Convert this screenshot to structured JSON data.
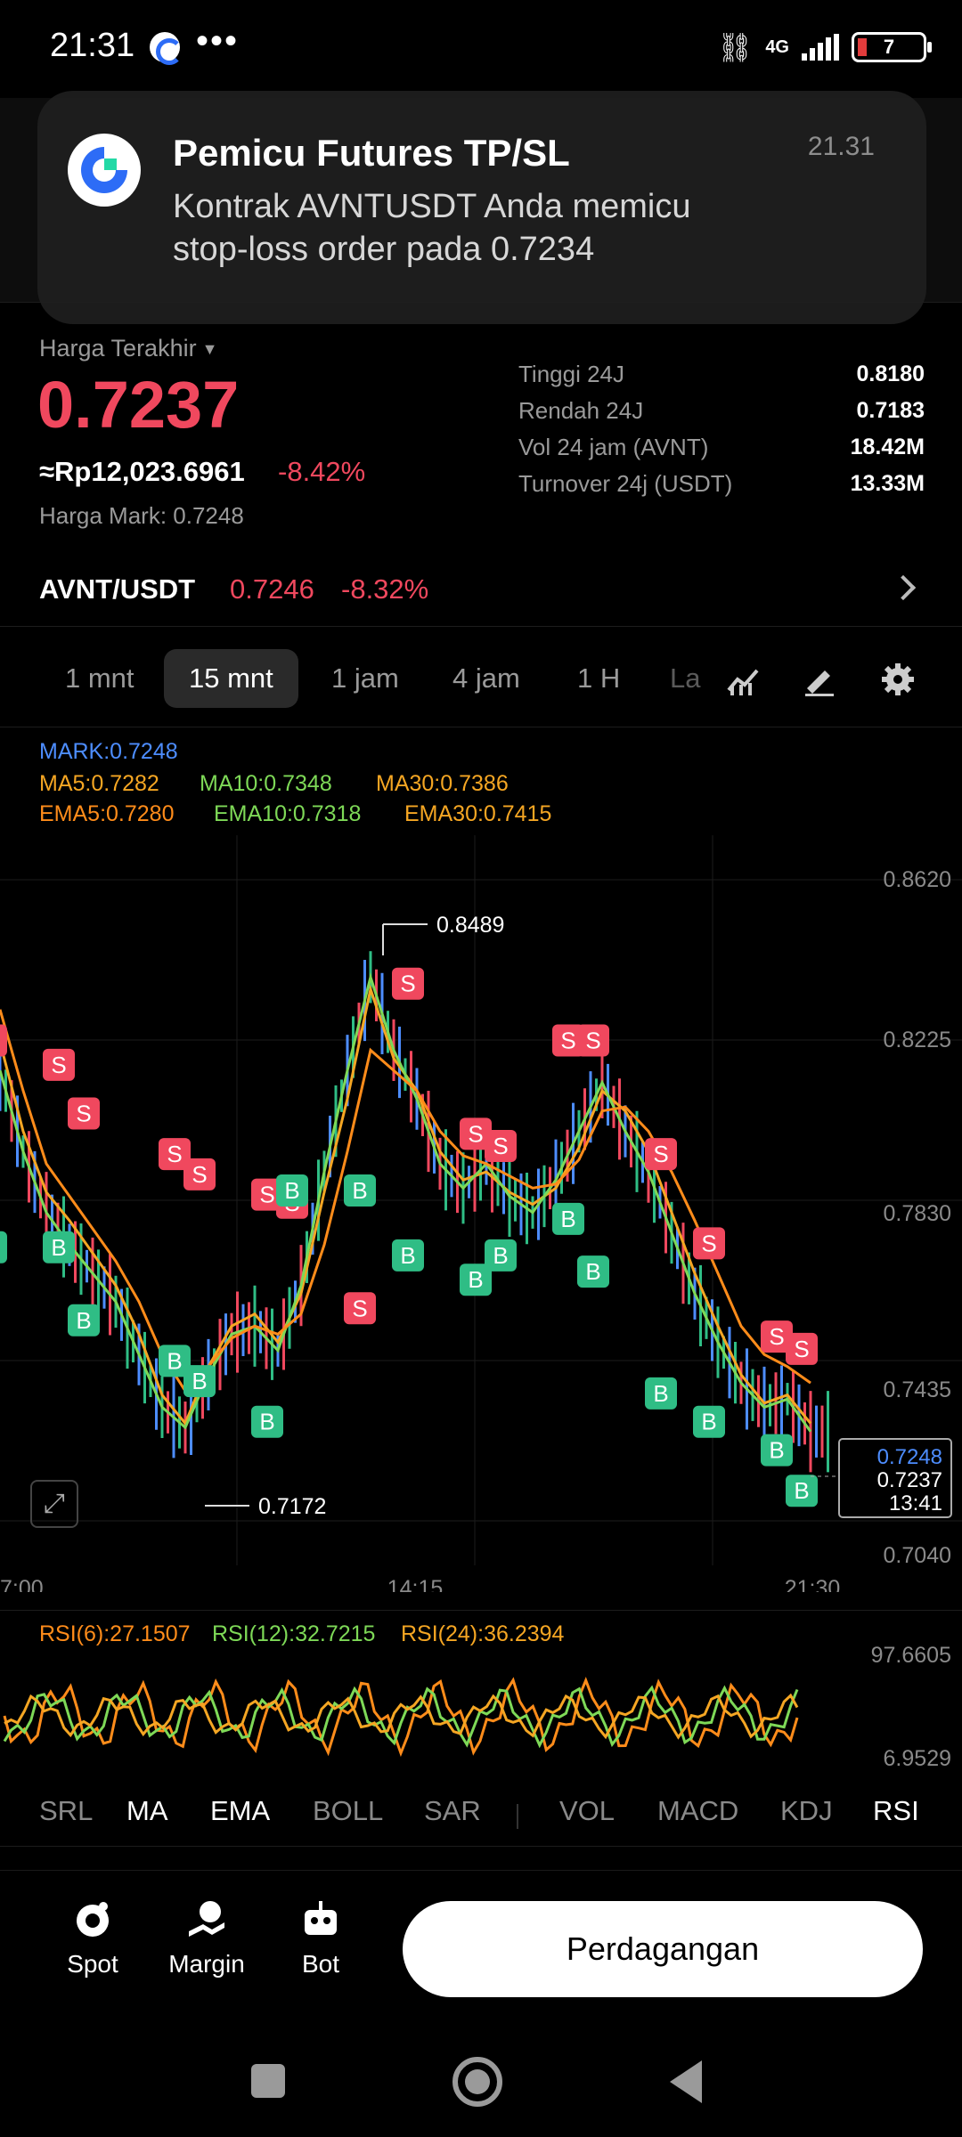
{
  "status_bar": {
    "time": "21:31",
    "dots": "•••",
    "network": "4G",
    "battery": "7"
  },
  "notification": {
    "title": "Pemicu Futures TP/SL",
    "time": "21.31",
    "body": "Kontrak AVNTUSDT Anda memicu stop-loss order pada 0.7234",
    "app_icon": "gate-logo-icon"
  },
  "ticker": {
    "last_price_label": "Harga Terakhir",
    "last_price": "0.7237",
    "idr_value": "≈Rp12,023.6961",
    "change_pct": "-8.42%",
    "mark_label": "Harga Mark:",
    "mark_value": "0.7248",
    "stats": [
      {
        "label": "Tinggi 24J",
        "value": "0.8180"
      },
      {
        "label": "Rendah 24J",
        "value": "0.7183"
      },
      {
        "label": "Vol 24 jam (AVNT)",
        "value": "18.42M"
      },
      {
        "label": "Turnover 24j (USDT)",
        "value": "13.33M"
      }
    ],
    "pair": {
      "name": "AVNT/USDT",
      "price": "0.7246",
      "change": "-8.32%"
    },
    "down_color": "#f0485e",
    "up_color": "#2fbd85"
  },
  "intervals": {
    "items": [
      "1 mnt",
      "15 mnt",
      "1 jam",
      "4 jam",
      "1 H",
      "La"
    ],
    "active": "15 mnt",
    "tools": [
      "indicator-icon",
      "draw-pen-icon",
      "settings-gear-icon"
    ]
  },
  "indicators_legend": {
    "mark": "MARK:0.7248",
    "ma5": "MA5:0.7282",
    "ma10": "MA10:0.7348",
    "ma30": "MA30:0.7386",
    "ema5": "EMA5:0.7280",
    "ema10": "EMA10:0.7318",
    "ema30": "EMA30:0.7415"
  },
  "chart_data": {
    "type": "line",
    "y_ticks": [
      "0.8620",
      "0.8225",
      "0.7830",
      "0.7435",
      "0.7040"
    ],
    "ylim": [
      0.704,
      0.862
    ],
    "x_ticks": [
      "7:00",
      "14:15",
      "21:30"
    ],
    "high_label": "0.8489",
    "low_label": "0.7172",
    "current_mark": "0.7248",
    "current_last": "0.7237",
    "countdown": "13:41",
    "series": [
      {
        "color": "#f5a623",
        "values": [
          0.822,
          0.8,
          0.785,
          0.778,
          0.77,
          0.762,
          0.75,
          0.735,
          0.728,
          0.742,
          0.752,
          0.755,
          0.748,
          0.76,
          0.785,
          0.808,
          0.835,
          0.818,
          0.81,
          0.795,
          0.788,
          0.79,
          0.785,
          0.782,
          0.786,
          0.796,
          0.81,
          0.805,
          0.795,
          0.78,
          0.765,
          0.752,
          0.74,
          0.733,
          0.735,
          0.728
        ]
      },
      {
        "color": "#7ed957",
        "values": [
          0.815,
          0.795,
          0.78,
          0.772,
          0.765,
          0.758,
          0.745,
          0.732,
          0.727,
          0.74,
          0.75,
          0.752,
          0.746,
          0.762,
          0.79,
          0.815,
          0.838,
          0.82,
          0.808,
          0.792,
          0.786,
          0.792,
          0.784,
          0.78,
          0.788,
          0.8,
          0.812,
          0.8,
          0.79,
          0.775,
          0.76,
          0.748,
          0.738,
          0.732,
          0.734,
          0.726
        ]
      },
      {
        "color": "#ff8c1a",
        "values": [
          0.83,
          0.81,
          0.792,
          0.784,
          0.776,
          0.768,
          0.758,
          0.745,
          0.736,
          0.742,
          0.749,
          0.752,
          0.75,
          0.755,
          0.772,
          0.795,
          0.82,
          0.815,
          0.81,
          0.8,
          0.794,
          0.792,
          0.789,
          0.786,
          0.787,
          0.793,
          0.805,
          0.806,
          0.8,
          0.79,
          0.778,
          0.765,
          0.752,
          0.745,
          0.742,
          0.738
        ]
      }
    ],
    "sells": [
      [
        0.818
      ],
      [
        0.812
      ],
      [
        0.8
      ],
      [
        0.79
      ],
      [
        0.785
      ],
      [
        0.78
      ],
      [
        0.778
      ],
      [
        0.752
      ],
      [
        0.832
      ],
      [
        0.795
      ],
      [
        0.792
      ],
      [
        0.818
      ],
      [
        0.818
      ],
      [
        0.79
      ],
      [
        0.768
      ],
      [
        0.745
      ],
      [
        0.742
      ]
    ],
    "buys": [
      [
        0.778
      ],
      [
        0.778
      ],
      [
        0.76
      ],
      [
        0.75
      ],
      [
        0.745
      ],
      [
        0.735
      ],
      [
        0.792
      ],
      [
        0.792
      ],
      [
        0.776
      ],
      [
        0.77
      ],
      [
        0.776
      ],
      [
        0.785
      ],
      [
        0.772
      ],
      [
        0.742
      ],
      [
        0.735
      ],
      [
        0.728
      ],
      [
        0.718
      ]
    ]
  },
  "rsi": {
    "rsi6": "RSI(6):27.1507",
    "rsi12": "RSI(12):32.7215",
    "rsi24": "RSI(24):36.2394",
    "top": "97.6605",
    "bottom": "6.9529"
  },
  "indicator_tabs": [
    "SRL",
    "MA",
    "EMA",
    "BOLL",
    "SAR",
    "VOL",
    "MACD",
    "KDJ",
    "RSI"
  ],
  "bottom_nav": {
    "spot": "Spot",
    "margin": "Margin",
    "bot": "Bot",
    "trade": "Perdagangan"
  }
}
